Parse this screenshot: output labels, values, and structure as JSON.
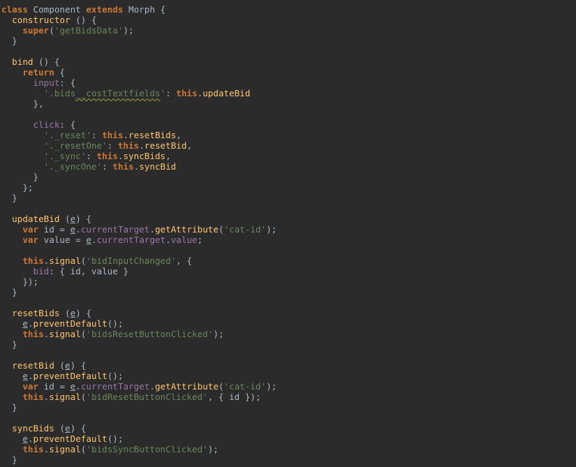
{
  "editor": {
    "colors": {
      "background": "#2b2b2b",
      "keyword": "#cc7832",
      "function": "#ffc66d",
      "property": "#9876aa",
      "string": "#6a8759",
      "text": "#a9b7c6"
    },
    "lines": [
      [
        [
          "kw",
          "class"
        ],
        [
          "pl",
          " Component "
        ],
        [
          "kw",
          "extends"
        ],
        [
          "pl",
          " Morph {"
        ]
      ],
      [
        [
          "pl",
          "  "
        ],
        [
          "fn",
          "constructor"
        ],
        [
          "pl",
          " () {"
        ]
      ],
      [
        [
          "pl",
          "    "
        ],
        [
          "kw",
          "super"
        ],
        [
          "pl",
          "("
        ],
        [
          "str",
          "'getBidsData'"
        ],
        [
          "pl",
          ");"
        ]
      ],
      [
        [
          "pl",
          "  }"
        ]
      ],
      [
        [
          "pl",
          ""
        ]
      ],
      [
        [
          "pl",
          "  "
        ],
        [
          "fn",
          "bind"
        ],
        [
          "pl",
          " () {"
        ]
      ],
      [
        [
          "pl",
          "    "
        ],
        [
          "kw",
          "return"
        ],
        [
          "pl",
          " {"
        ]
      ],
      [
        [
          "pl",
          "      "
        ],
        [
          "prop",
          "input"
        ],
        [
          "pl",
          ": {"
        ]
      ],
      [
        [
          "pl",
          "        "
        ],
        [
          "str",
          "'.bids"
        ],
        [
          "str",
          "__costTextfields"
        ],
        [
          "str",
          "'"
        ],
        [
          "pl",
          ": "
        ],
        [
          "kw",
          "this"
        ],
        [
          "pl",
          "."
        ],
        [
          "fn",
          "updateBid"
        ]
      ],
      [
        [
          "pl",
          "      },"
        ]
      ],
      [
        [
          "pl",
          ""
        ]
      ],
      [
        [
          "pl",
          "      "
        ],
        [
          "prop",
          "click"
        ],
        [
          "pl",
          ": {"
        ]
      ],
      [
        [
          "pl",
          "        "
        ],
        [
          "str",
          "'._reset'"
        ],
        [
          "pl",
          ": "
        ],
        [
          "kw",
          "this"
        ],
        [
          "pl",
          "."
        ],
        [
          "fn",
          "resetBids"
        ],
        [
          "pl",
          ","
        ]
      ],
      [
        [
          "pl",
          "        "
        ],
        [
          "str",
          "'._resetOne'"
        ],
        [
          "pl",
          ": "
        ],
        [
          "kw",
          "this"
        ],
        [
          "pl",
          "."
        ],
        [
          "fn",
          "resetBid"
        ],
        [
          "pl",
          ","
        ]
      ],
      [
        [
          "pl",
          "        "
        ],
        [
          "str",
          "'._sync'"
        ],
        [
          "pl",
          ": "
        ],
        [
          "kw",
          "this"
        ],
        [
          "pl",
          "."
        ],
        [
          "fn",
          "syncBids"
        ],
        [
          "pl",
          ","
        ]
      ],
      [
        [
          "pl",
          "        "
        ],
        [
          "str",
          "'._syncOne'"
        ],
        [
          "pl",
          ": "
        ],
        [
          "kw",
          "this"
        ],
        [
          "pl",
          "."
        ],
        [
          "fn",
          "syncBid"
        ]
      ],
      [
        [
          "pl",
          "      }"
        ]
      ],
      [
        [
          "pl",
          "    };"
        ]
      ],
      [
        [
          "pl",
          "  }"
        ]
      ],
      [
        [
          "pl",
          ""
        ]
      ],
      [
        [
          "pl",
          "  "
        ],
        [
          "fn",
          "updateBid"
        ],
        [
          "pl",
          " ("
        ],
        [
          "param",
          "e"
        ],
        [
          "pl",
          ") {"
        ]
      ],
      [
        [
          "pl",
          "    "
        ],
        [
          "kw",
          "var"
        ],
        [
          "pl",
          " id = "
        ],
        [
          "param",
          "e"
        ],
        [
          "pl",
          "."
        ],
        [
          "prop",
          "currentTarget"
        ],
        [
          "pl",
          "."
        ],
        [
          "fn",
          "getAttribute"
        ],
        [
          "pl",
          "("
        ],
        [
          "str",
          "'cat-id'"
        ],
        [
          "pl",
          ");"
        ]
      ],
      [
        [
          "pl",
          "    "
        ],
        [
          "kw",
          "var"
        ],
        [
          "pl",
          " value = "
        ],
        [
          "param",
          "e"
        ],
        [
          "pl",
          "."
        ],
        [
          "prop",
          "currentTarget"
        ],
        [
          "pl",
          "."
        ],
        [
          "prop",
          "value"
        ],
        [
          "pl",
          ";"
        ]
      ],
      [
        [
          "pl",
          ""
        ]
      ],
      [
        [
          "pl",
          "    "
        ],
        [
          "kw",
          "this"
        ],
        [
          "pl",
          "."
        ],
        [
          "fn",
          "signal"
        ],
        [
          "pl",
          "("
        ],
        [
          "str",
          "'bidInputChanged'"
        ],
        [
          "pl",
          ", {"
        ]
      ],
      [
        [
          "pl",
          "      "
        ],
        [
          "prop",
          "bid"
        ],
        [
          "pl",
          ": { id, value }"
        ]
      ],
      [
        [
          "pl",
          "    });"
        ]
      ],
      [
        [
          "pl",
          "  }"
        ]
      ],
      [
        [
          "pl",
          ""
        ]
      ],
      [
        [
          "pl",
          "  "
        ],
        [
          "fn",
          "resetBids"
        ],
        [
          "pl",
          " ("
        ],
        [
          "param",
          "e"
        ],
        [
          "pl",
          ") {"
        ]
      ],
      [
        [
          "pl",
          "    "
        ],
        [
          "param",
          "e"
        ],
        [
          "pl",
          "."
        ],
        [
          "fn",
          "preventDefault"
        ],
        [
          "pl",
          "();"
        ]
      ],
      [
        [
          "pl",
          "    "
        ],
        [
          "kw",
          "this"
        ],
        [
          "pl",
          "."
        ],
        [
          "fn",
          "signal"
        ],
        [
          "pl",
          "("
        ],
        [
          "str",
          "'bidsResetButtonClicked'"
        ],
        [
          "pl",
          ");"
        ]
      ],
      [
        [
          "pl",
          "  }"
        ]
      ],
      [
        [
          "pl",
          ""
        ]
      ],
      [
        [
          "pl",
          "  "
        ],
        [
          "fn",
          "resetBid"
        ],
        [
          "pl",
          " ("
        ],
        [
          "param",
          "e"
        ],
        [
          "pl",
          ") {"
        ]
      ],
      [
        [
          "pl",
          "    "
        ],
        [
          "param",
          "e"
        ],
        [
          "pl",
          "."
        ],
        [
          "fn",
          "preventDefault"
        ],
        [
          "pl",
          "();"
        ]
      ],
      [
        [
          "pl",
          "    "
        ],
        [
          "kw",
          "var"
        ],
        [
          "pl",
          " id = "
        ],
        [
          "param",
          "e"
        ],
        [
          "pl",
          "."
        ],
        [
          "prop",
          "currentTarget"
        ],
        [
          "pl",
          "."
        ],
        [
          "fn",
          "getAttribute"
        ],
        [
          "pl",
          "("
        ],
        [
          "str",
          "'cat-id'"
        ],
        [
          "pl",
          ");"
        ]
      ],
      [
        [
          "pl",
          "    "
        ],
        [
          "kw",
          "this"
        ],
        [
          "pl",
          "."
        ],
        [
          "fn",
          "signal"
        ],
        [
          "pl",
          "("
        ],
        [
          "str",
          "'bidResetButtonClicked'"
        ],
        [
          "pl",
          ", { id });"
        ]
      ],
      [
        [
          "pl",
          "  }"
        ]
      ],
      [
        [
          "pl",
          ""
        ]
      ],
      [
        [
          "pl",
          "  "
        ],
        [
          "fn",
          "syncBids"
        ],
        [
          "pl",
          " ("
        ],
        [
          "param",
          "e"
        ],
        [
          "pl",
          ") {"
        ]
      ],
      [
        [
          "pl",
          "    "
        ],
        [
          "param",
          "e"
        ],
        [
          "pl",
          "."
        ],
        [
          "fn",
          "preventDefault"
        ],
        [
          "pl",
          "();"
        ]
      ],
      [
        [
          "pl",
          "    "
        ],
        [
          "kw",
          "this"
        ],
        [
          "pl",
          "."
        ],
        [
          "fn",
          "signal"
        ],
        [
          "pl",
          "("
        ],
        [
          "str",
          "'bidsSyncButtonClicked'"
        ],
        [
          "pl",
          ");"
        ]
      ],
      [
        [
          "pl",
          "  }"
        ]
      ]
    ]
  }
}
